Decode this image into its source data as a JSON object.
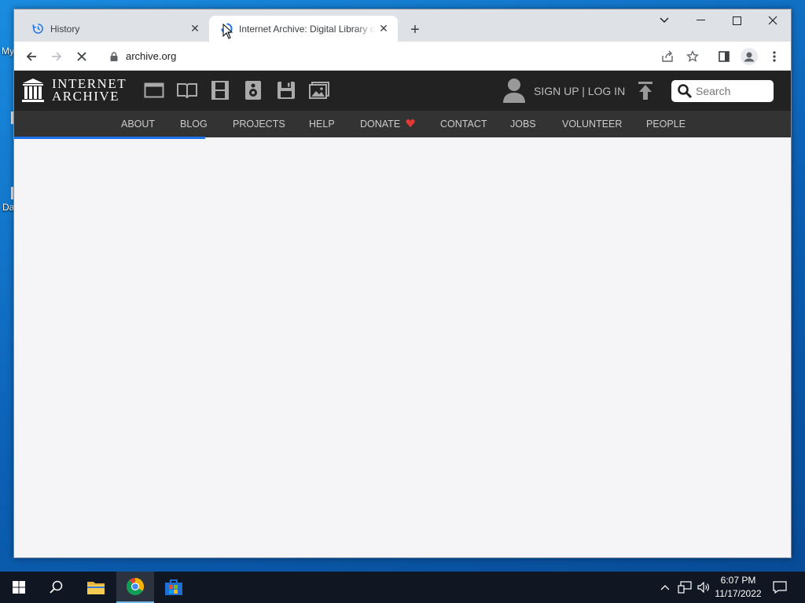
{
  "desktop": {
    "label_1": "My",
    "label_2": "Da"
  },
  "browser": {
    "tabs": [
      {
        "title": "History",
        "icon": "history-icon",
        "active": false
      },
      {
        "title": "Internet Archive: Digital Library of Free & Borrowable Books, Movies, Music & Wayback Machine",
        "icon": "loading-spinner-icon",
        "active": true
      }
    ],
    "new_tab_label": "+",
    "url": "archive.org"
  },
  "site": {
    "logo_line1": "INTERNET",
    "logo_line2": "ARCHIVE",
    "media_icons": [
      "web-icon",
      "texts-icon",
      "video-icon",
      "audio-icon",
      "software-icon",
      "images-icon"
    ],
    "account_link": "SIGN UP | LOG IN",
    "search_placeholder": "Search",
    "nav": [
      "ABOUT",
      "BLOG",
      "PROJECTS",
      "HELP",
      "DONATE",
      "CONTACT",
      "JOBS",
      "VOLUNTEER",
      "PEOPLE"
    ],
    "colors": {
      "topbar": "#222222",
      "navbar": "#333333",
      "donate_heart": "#e53935",
      "progress": "#1a73e8"
    }
  },
  "taskbar": {
    "time": "6:07 PM",
    "date": "11/17/2022"
  }
}
